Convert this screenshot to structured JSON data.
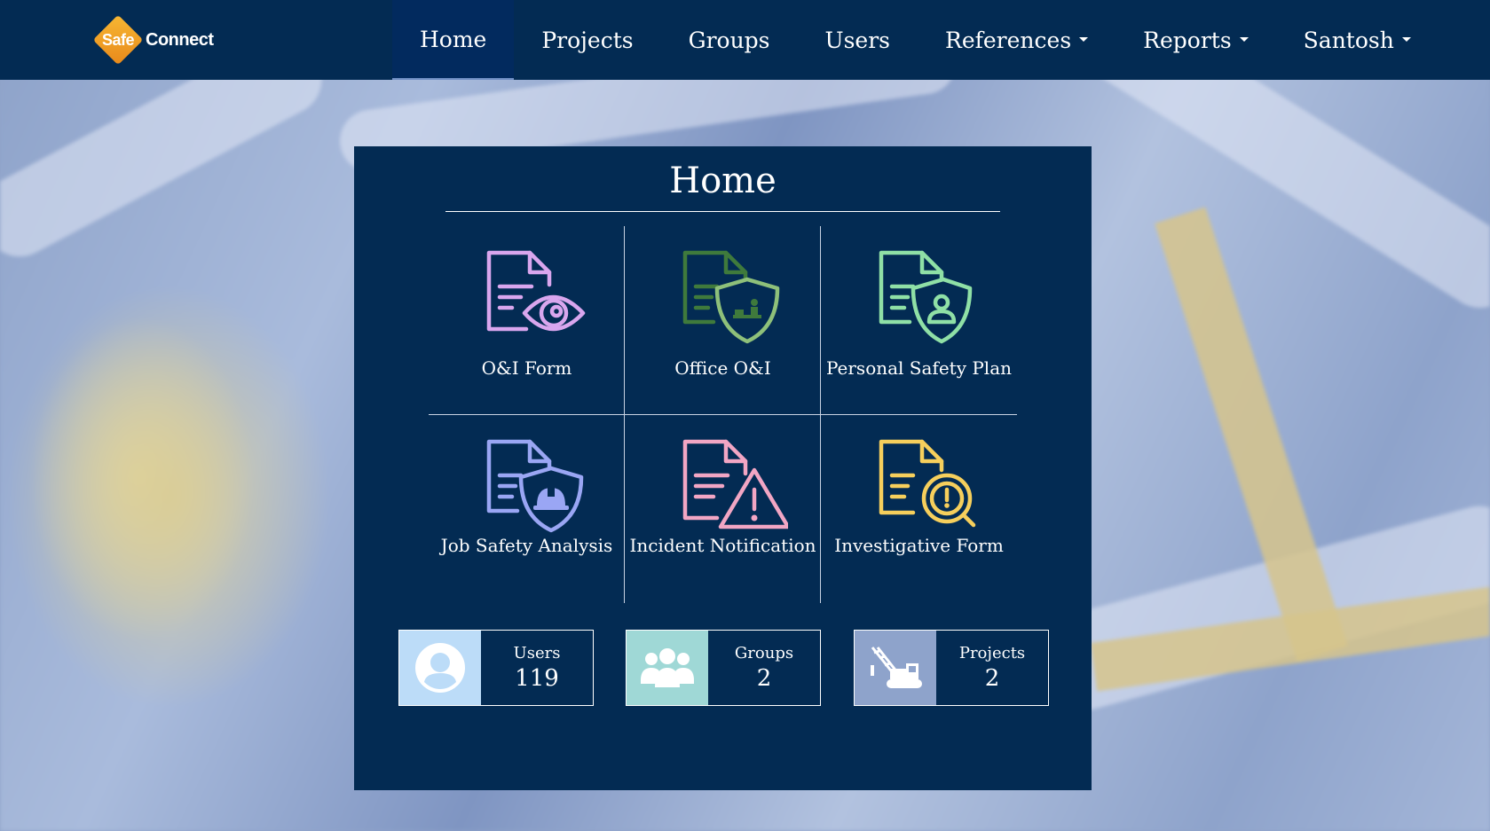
{
  "brand": {
    "badge": "Safe",
    "name": "Connect"
  },
  "nav": {
    "items": [
      {
        "label": "Home",
        "active": true,
        "dropdown": false
      },
      {
        "label": "Projects",
        "active": false,
        "dropdown": false
      },
      {
        "label": "Groups",
        "active": false,
        "dropdown": false
      },
      {
        "label": "Users",
        "active": false,
        "dropdown": false
      },
      {
        "label": "References",
        "active": false,
        "dropdown": true
      },
      {
        "label": "Reports",
        "active": false,
        "dropdown": true
      },
      {
        "label": "Santosh",
        "active": false,
        "dropdown": true
      }
    ]
  },
  "panel": {
    "title": "Home",
    "tiles": [
      {
        "label": "O&I Form",
        "icon": "document-eye-icon",
        "color": "#d9a6ee"
      },
      {
        "label": "Office O&I",
        "icon": "document-shield-worker-icon",
        "color": "#3f7a3c"
      },
      {
        "label": "Personal Safety Plan",
        "icon": "document-shield-person-icon",
        "color": "#8fe0a6"
      },
      {
        "label": "Job Safety Analysis",
        "icon": "document-shield-hardhat-icon",
        "color": "#9aa6f4"
      },
      {
        "label": "Incident Notification",
        "icon": "document-warning-icon",
        "color": "#f2a6c4"
      },
      {
        "label": "Investigative Form",
        "icon": "document-magnifier-icon",
        "color": "#f6cf5c"
      }
    ],
    "stats": [
      {
        "label": "Users",
        "value": "119",
        "icon": "user-icon",
        "color": "#bcdcf8"
      },
      {
        "label": "Groups",
        "value": "2",
        "icon": "group-icon",
        "color": "#9fd8d6"
      },
      {
        "label": "Projects",
        "value": "2",
        "icon": "crane-icon",
        "color": "#8ea3cb"
      }
    ]
  }
}
